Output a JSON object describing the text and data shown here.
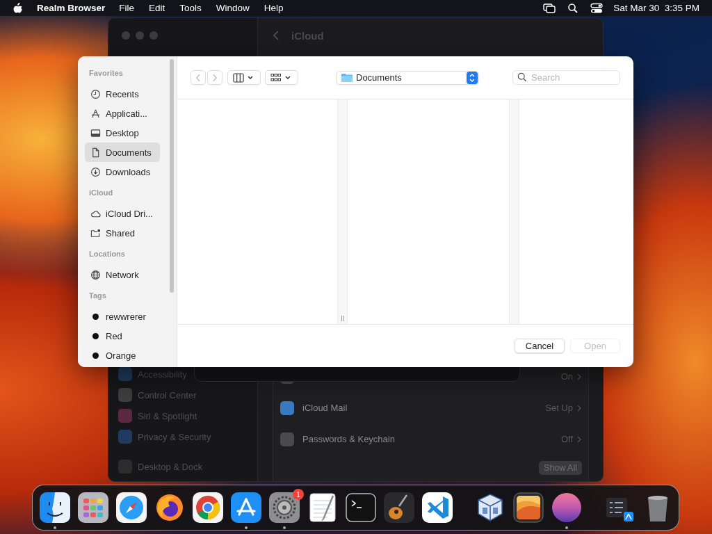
{
  "menu_bar": {
    "app_name": "Realm Browser",
    "menus": [
      "File",
      "Edit",
      "Tools",
      "Window",
      "Help"
    ],
    "clock": "Sat Mar 30  3:35 PM"
  },
  "settings_window": {
    "title": "iCloud",
    "sidebar": [
      "Accessibility",
      "Control Center",
      "Siri & Spotlight",
      "Privacy & Security",
      "Desktop & Dock"
    ],
    "rows": [
      {
        "label": "",
        "value": "On"
      },
      {
        "label": "iCloud Mail",
        "value": "Set Up"
      },
      {
        "label": "Passwords & Keychain",
        "value": "Off"
      }
    ],
    "show_all": "Show All"
  },
  "open_dialog": {
    "sidebar": [
      {
        "title": "Favorites",
        "kind": "places",
        "items": [
          {
            "label": "Recents",
            "selected": false
          },
          {
            "label": "Applicati...",
            "selected": false
          },
          {
            "label": "Desktop",
            "selected": false
          },
          {
            "label": "Documents",
            "selected": true
          },
          {
            "label": "Downloads",
            "selected": false
          }
        ]
      },
      {
        "title": "iCloud",
        "kind": "places",
        "items": [
          {
            "label": "iCloud Dri...",
            "selected": false
          },
          {
            "label": "Shared",
            "selected": false
          }
        ]
      },
      {
        "title": "Locations",
        "kind": "places",
        "items": [
          {
            "label": "Network",
            "selected": false
          }
        ]
      },
      {
        "title": "Tags",
        "kind": "tags",
        "items": [
          {
            "label": "rewwrerer",
            "selected": false
          },
          {
            "label": "Red",
            "selected": false
          },
          {
            "label": "Orange",
            "selected": false
          }
        ]
      }
    ],
    "location": "Documents",
    "search": {
      "placeholder": "Search"
    },
    "buttons": [
      {
        "label": "Cancel",
        "disabled": false
      },
      {
        "label": "Open",
        "disabled": true
      }
    ]
  },
  "dock": {
    "apps": [
      {
        "running": true
      },
      {
        "running": false
      },
      {
        "running": false
      },
      {
        "running": false
      },
      {
        "running": false
      },
      {
        "running": true
      },
      {
        "running": true,
        "badge": "1"
      },
      {
        "running": false
      },
      {
        "running": false
      },
      {
        "running": false
      },
      {
        "running": false
      }
    ],
    "others": [
      {
        "running": false
      },
      {
        "running": false
      },
      {
        "running": true
      }
    ],
    "stacks": [
      {
        "running": false
      },
      {
        "running": false
      }
    ]
  }
}
